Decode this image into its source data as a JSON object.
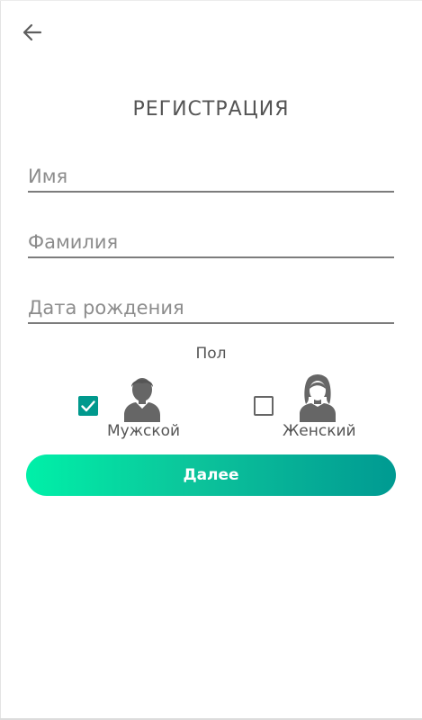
{
  "header": {
    "title": "РЕГИСТРАЦИЯ",
    "back_icon": "arrow-left-icon"
  },
  "form": {
    "first_name": {
      "placeholder": "Имя",
      "value": ""
    },
    "last_name": {
      "placeholder": "Фамилия",
      "value": ""
    },
    "birth_date": {
      "placeholder": "Дата рождения",
      "value": ""
    }
  },
  "gender": {
    "label": "Пол",
    "male": {
      "label": "Мужской",
      "checked": true,
      "icon": "male-user-icon"
    },
    "female": {
      "label": "Женский",
      "checked": false,
      "icon": "female-user-icon"
    }
  },
  "actions": {
    "next_label": "Далее"
  },
  "colors": {
    "accent": "#00998d",
    "gradient_start": "#00f0a8",
    "gradient_end": "#009a92",
    "icon_gray": "#666666"
  }
}
